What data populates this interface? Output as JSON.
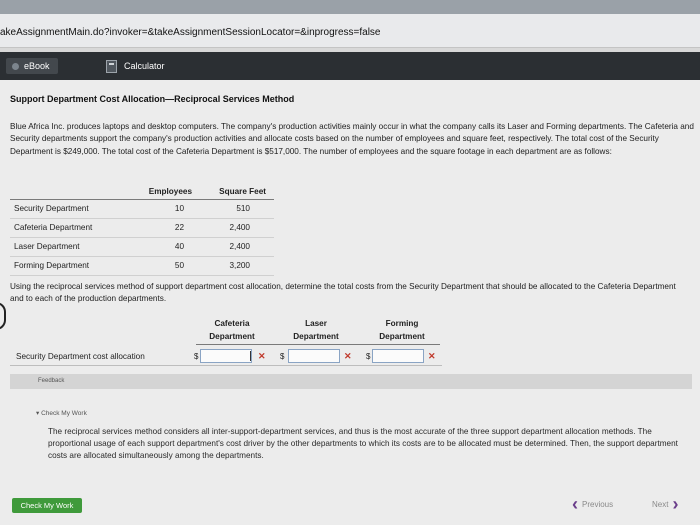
{
  "browser": {
    "url": "akeAssignmentMain.do?invoker=&takeAssignmentSessionLocator=&inprogress=false"
  },
  "toolbar": {
    "ebook_label": "eBook",
    "calculator_label": "Calculator",
    "icons": [
      "ebook-icon",
      "calculator-icon"
    ]
  },
  "problem": {
    "title": "Support Department Cost Allocation—Reciprocal Services Method",
    "intro": "Blue Africa Inc. produces laptops and desktop computers. The company's production activities mainly occur in what the company calls its Laser and Forming departments. The Cafeteria and Security departments support the company's production activities and allocate costs based on the number of employees and square feet, respectively. The total cost of the Security Department is $249,000. The total cost of the Cafeteria Department is $517,000. The number of employees and the square footage in each department are as follows:",
    "table": {
      "headers": [
        "Employees",
        "Square Feet"
      ],
      "rows": [
        {
          "dept": "Security Department",
          "employees": "10",
          "sqft": "510"
        },
        {
          "dept": "Cafeteria Department",
          "employees": "22",
          "sqft": "2,400"
        },
        {
          "dept": "Laser Department",
          "employees": "40",
          "sqft": "2,400"
        },
        {
          "dept": "Forming Department",
          "employees": "50",
          "sqft": "3,200"
        }
      ]
    },
    "question": "Using the reciprocal services method of support department cost allocation, determine the total costs from the Security Department that should be allocated to the Cafeteria Department and to each of the production departments.",
    "allocation": {
      "headers": [
        {
          "line1": "Cafeteria",
          "line2": "Department"
        },
        {
          "line1": "Laser",
          "line2": "Department"
        },
        {
          "line1": "Forming",
          "line2": "Department"
        }
      ],
      "row_label": "Security Department cost allocation",
      "currency": "$",
      "inputs": [
        "",
        "",
        ""
      ],
      "status": "incorrect"
    }
  },
  "feedback": {
    "label": "Feedback",
    "check_my_work": "Check My Work",
    "explanation": "The reciprocal services method considers all inter-support-department services, and thus is the most accurate of the three support department allocation methods. The proportional usage of each support department's cost driver by the other departments to which its costs are to be allocated must be determined. Then, the support department costs are allocated simultaneously among the departments."
  },
  "footer": {
    "check_button": "Check My Work",
    "previous": "Previous",
    "next": "Next"
  },
  "colors": {
    "toolbar_bg": "#2b2f33",
    "check_button": "#3f9a3b",
    "error_x": "#c0392b",
    "nav_chevron": "#6a3d8a"
  }
}
